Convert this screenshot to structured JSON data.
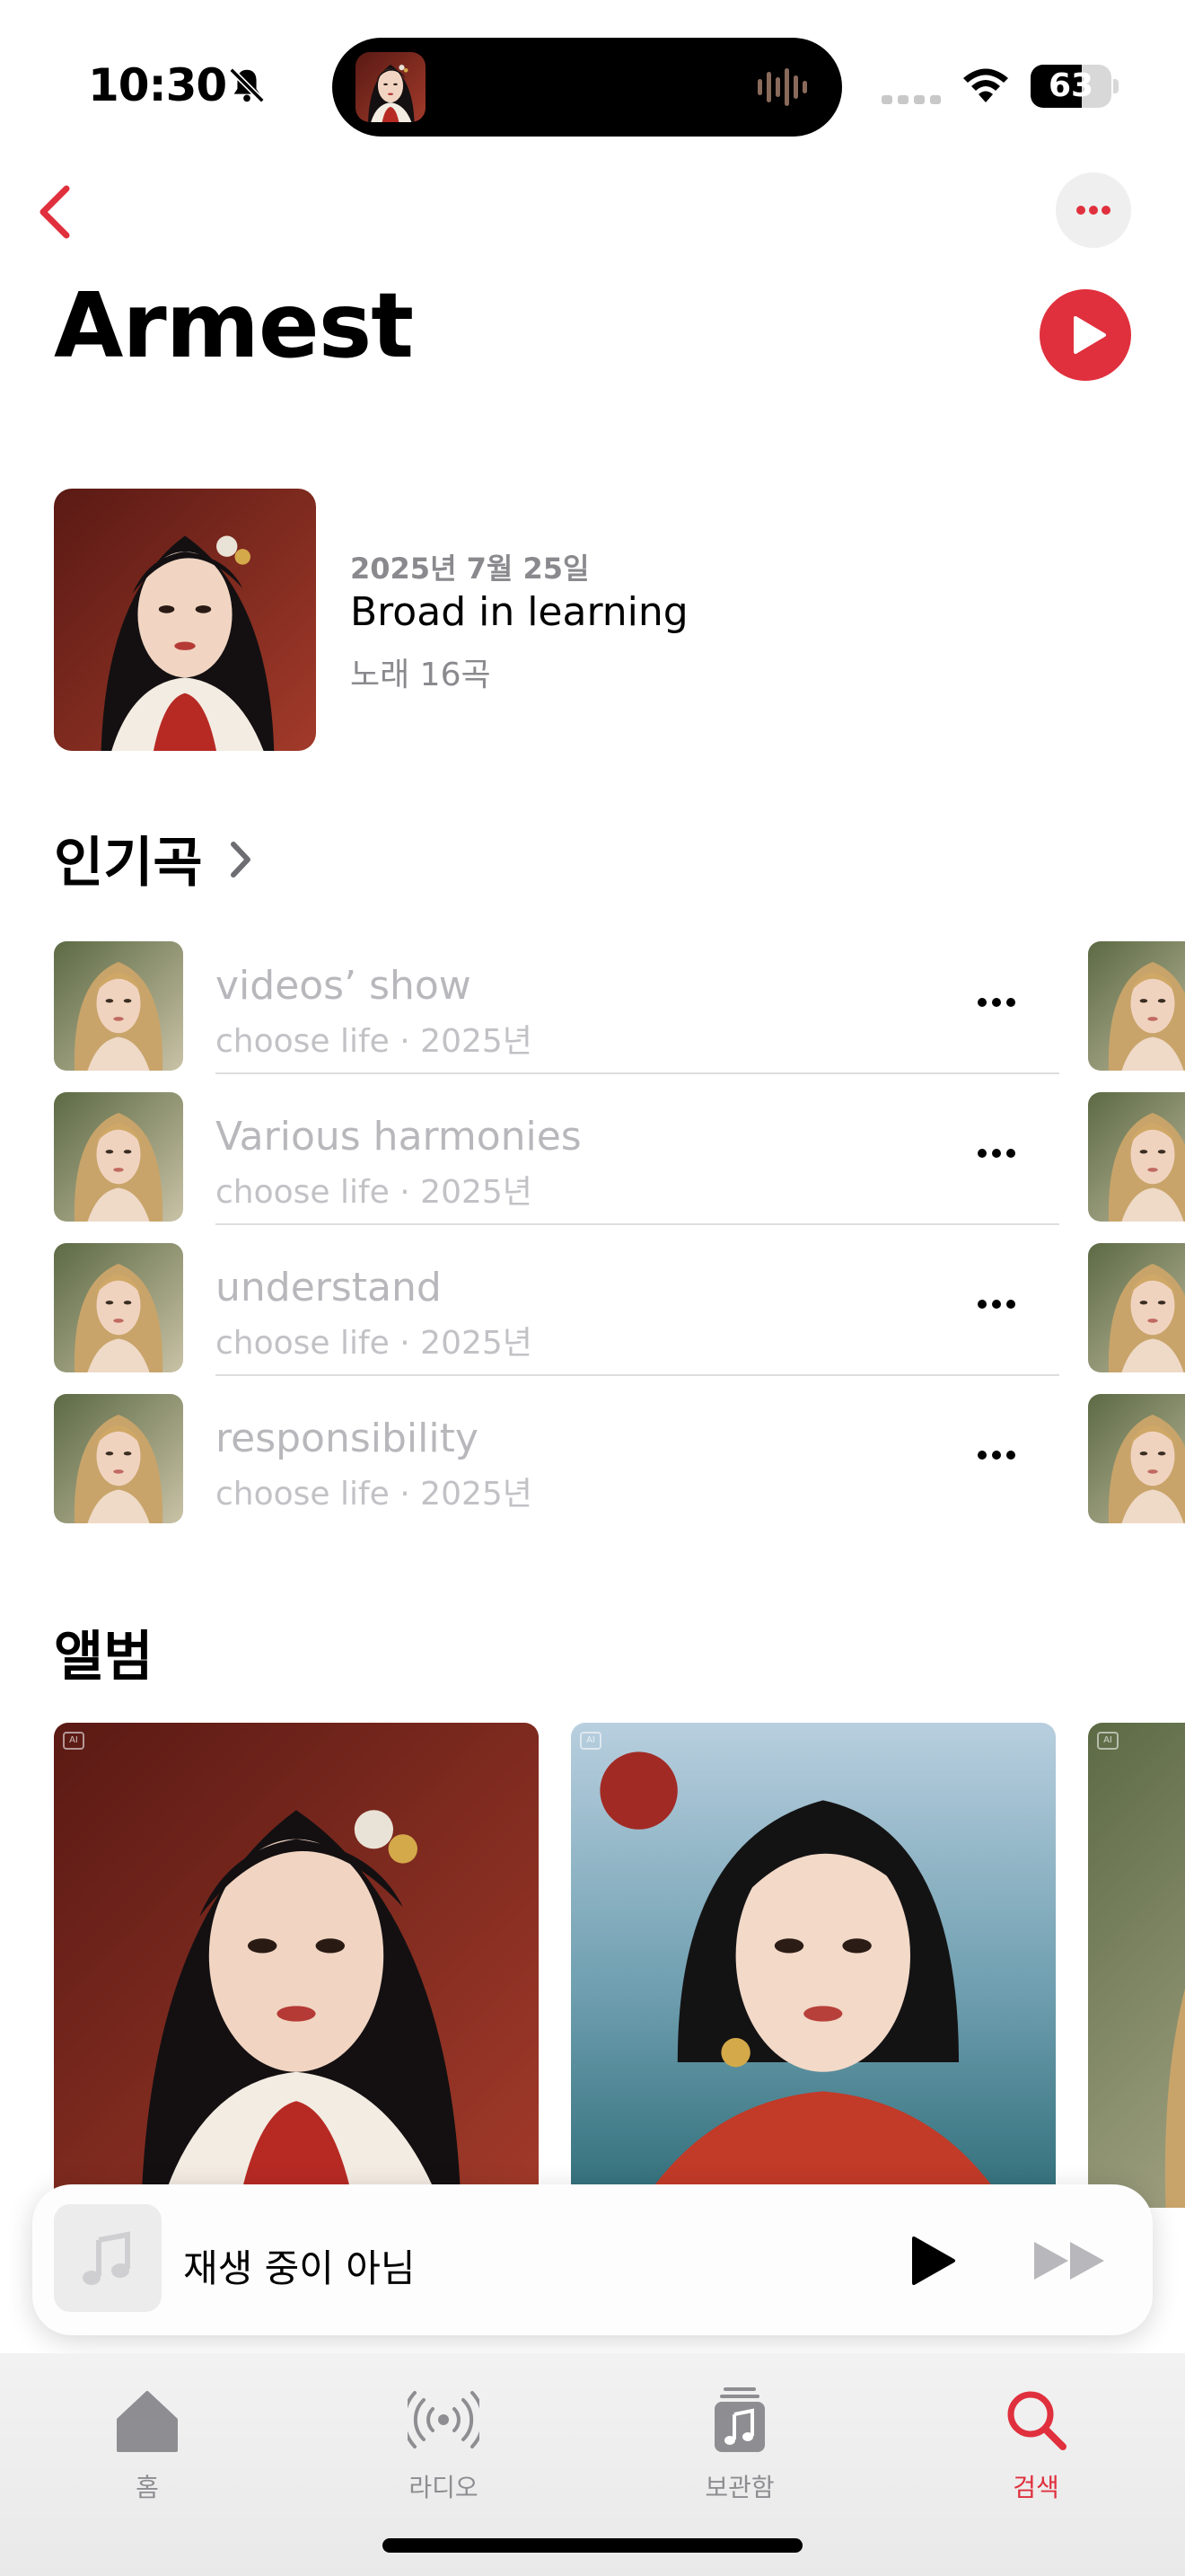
{
  "status_bar": {
    "time": "10:30",
    "battery": "63",
    "battery_level": 0.63
  },
  "header": {
    "title": "Armest"
  },
  "latest_release": {
    "date": "2025년 7월 25일",
    "title": "Broad in learning",
    "count": "노래 16곡"
  },
  "top_songs": {
    "heading": "인기곡",
    "items": [
      {
        "title": "videos’ show",
        "subtitle": "choose life · 2025년"
      },
      {
        "title": "Various harmonies",
        "subtitle": "choose life · 2025년"
      },
      {
        "title": "understand",
        "subtitle": "choose life · 2025년"
      },
      {
        "title": "responsibility",
        "subtitle": "choose life · 2025년"
      }
    ]
  },
  "albums": {
    "heading": "앨범",
    "badge": "AI"
  },
  "mini_player": {
    "title": "재생 중이 아님"
  },
  "tab_bar": {
    "items": [
      {
        "label": "홈",
        "icon": "house-icon"
      },
      {
        "label": "라디오",
        "icon": "radio-icon"
      },
      {
        "label": "보관함",
        "icon": "library-icon"
      },
      {
        "label": "검색",
        "icon": "search-icon"
      }
    ],
    "active": "검색"
  },
  "colors": {
    "accent": "#e0303d",
    "secondary_text": "#8a8a8e",
    "tab_inactive": "#8e8e92"
  }
}
